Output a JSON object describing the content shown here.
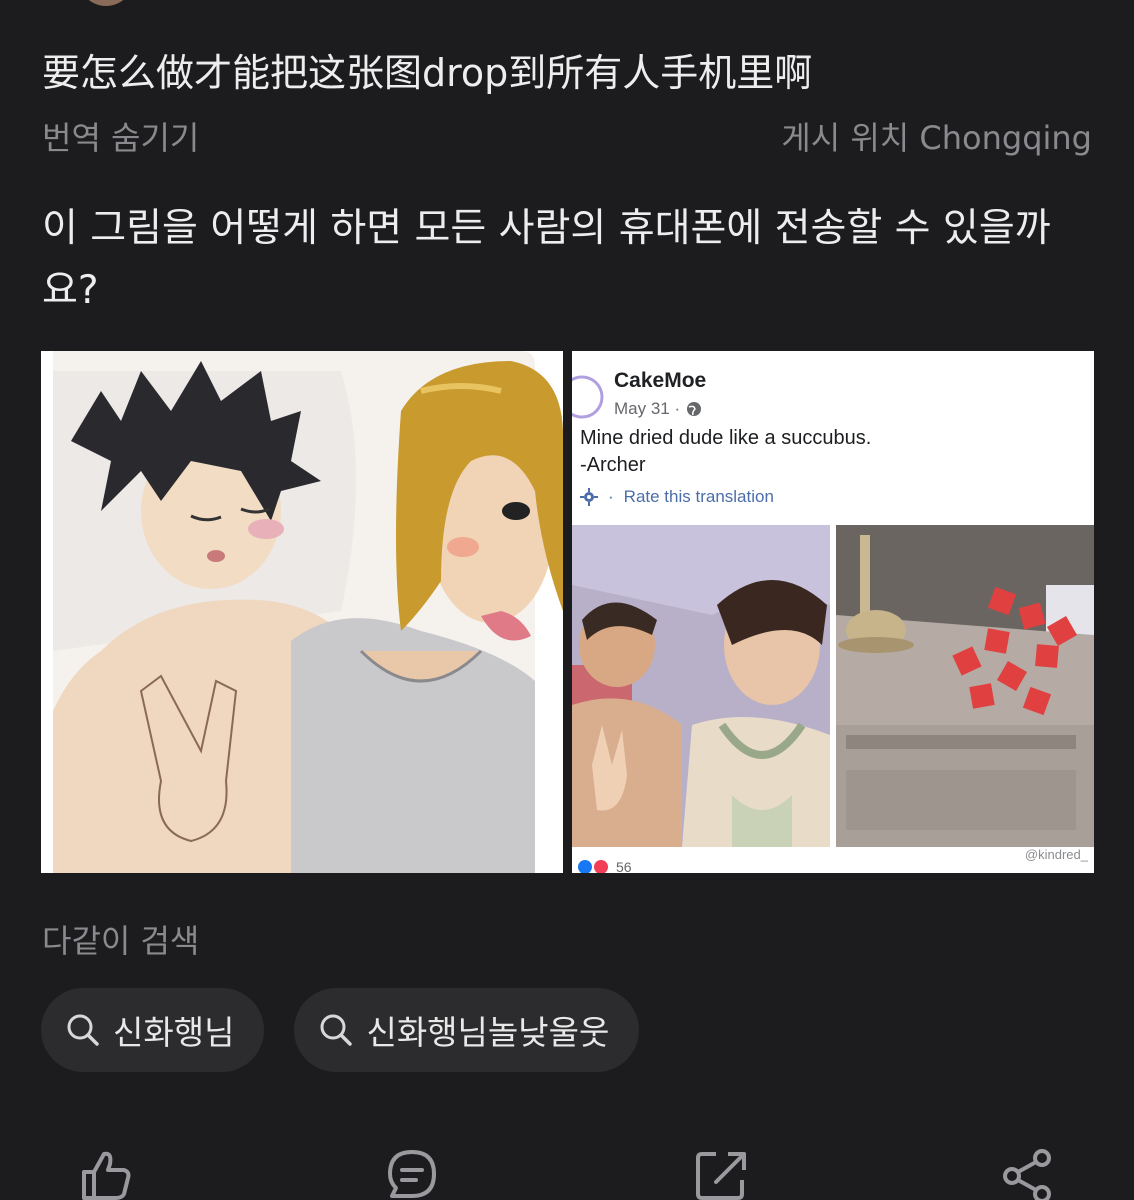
{
  "post": {
    "title": "要怎么做才能把这张图drop到所有人手机里啊",
    "hide_translation_label": "번역 숨기기",
    "location": "게시 위치 Chongqing",
    "translation": "이 그림을 어떻게 하면 모든 사람의 휴대폰에 전송할 수 있을까요?"
  },
  "media": {
    "left_image": {
      "kind": "illustration"
    },
    "right_image": {
      "kind": "facebook-screenshot",
      "author": "CakeMoe",
      "date": "May 31 ·",
      "text_line1": "Mine dried dude like a succubus.",
      "text_line2": "-Archer",
      "rate_label": "Rate this translation",
      "reaction_count": "56",
      "watermark": "@kindred_"
    }
  },
  "similar": {
    "heading": "다같이 검색",
    "chips": [
      {
        "label": "신화행님",
        "icon": "search-icon"
      },
      {
        "label": "신화행님놀낮울웃",
        "icon": "search-icon"
      }
    ]
  },
  "actions": [
    {
      "name": "like-icon"
    },
    {
      "name": "comment-icon"
    },
    {
      "name": "external-link-icon"
    },
    {
      "name": "share-icon"
    }
  ],
  "colors": {
    "background": "#1c1c1e",
    "chip_background": "#2c2c2e",
    "primary_text": "#ededed",
    "secondary_text": "#8a8a8e"
  }
}
